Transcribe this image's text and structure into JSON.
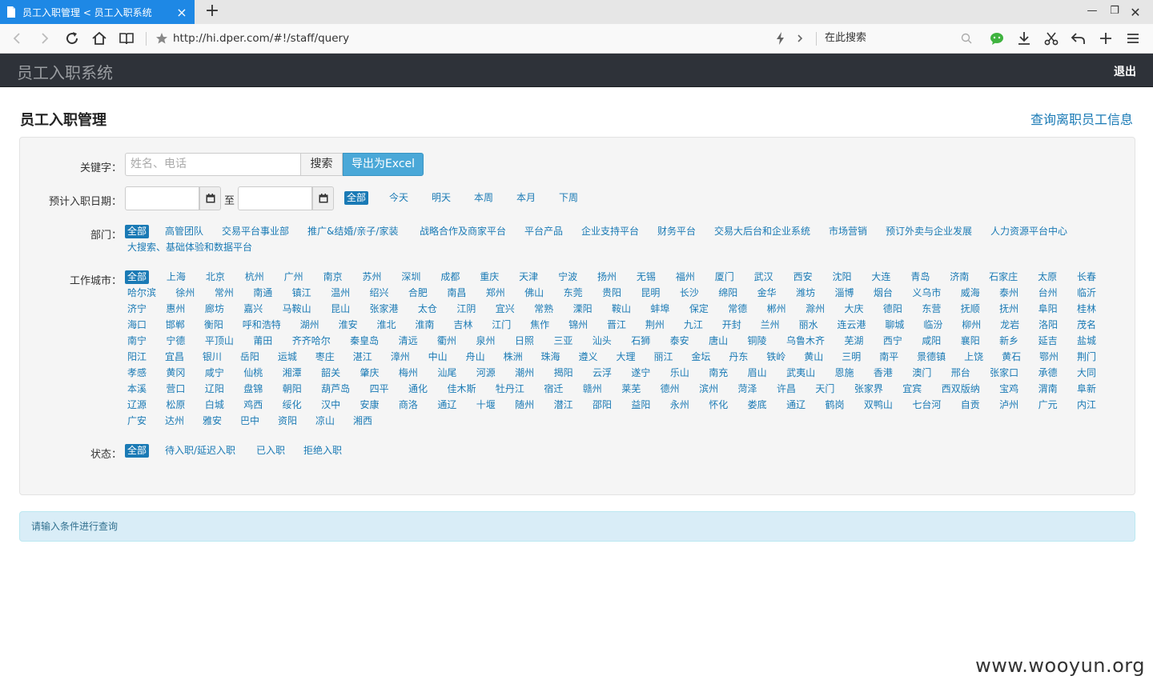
{
  "browser": {
    "tab_title": "员工入职管理 < 员工入职系统",
    "url": "http://hi.dper.com/#!/staff/query",
    "search_placeholder": "在此搜索"
  },
  "app": {
    "brand": "员工入职系统",
    "logout": "退出"
  },
  "page": {
    "title": "员工入职管理",
    "resigned_link": "查询离职员工信息"
  },
  "filters": {
    "keyword_label": "关键字：",
    "keyword_placeholder": "姓名、电话",
    "search_button": "搜索",
    "export_button": "导出为Excel",
    "date_label": "预计入职日期：",
    "date_to": "至",
    "date_options": [
      "全部",
      "今天",
      "明天",
      "本周",
      "本月",
      "下周"
    ],
    "dept_label": "部门：",
    "departments": [
      "全部",
      "高管团队",
      "交易平台事业部",
      "推广&结婚/亲子/家装",
      "战略合作及商家平台",
      "平台产品",
      "企业支持平台",
      "财务平台",
      "交易大后台和企业系统",
      "市场营销",
      "预订外卖与企业发展",
      "人力资源平台中心",
      "大搜索、基础体验和数据平台"
    ],
    "city_label": "工作城市：",
    "cities": [
      [
        "全部",
        "上海",
        "北京",
        "杭州",
        "广州",
        "南京",
        "苏州",
        "深圳",
        "成都",
        "重庆",
        "天津",
        "宁波",
        "扬州",
        "无锡",
        "福州",
        "厦门",
        "武汉",
        "西安",
        "沈阳",
        "大连",
        "青岛",
        "济南",
        "石家庄",
        "太原",
        "长春"
      ],
      [
        "哈尔滨",
        "徐州",
        "常州",
        "南通",
        "镇江",
        "温州",
        "绍兴",
        "合肥",
        "南昌",
        "郑州",
        "佛山",
        "东莞",
        "贵阳",
        "昆明",
        "长沙",
        "绵阳",
        "金华",
        "潍坊",
        "淄博",
        "烟台",
        "义乌市",
        "威海",
        "泰州",
        "台州",
        "临沂"
      ],
      [
        "济宁",
        "惠州",
        "廊坊",
        "嘉兴",
        "马鞍山",
        "昆山",
        "张家港",
        "太仓",
        "江阴",
        "宜兴",
        "常熟",
        "溧阳",
        "鞍山",
        "蚌埠",
        "保定",
        "常德",
        "郴州",
        "滁州",
        "大庆",
        "德阳",
        "东营",
        "抚顺",
        "抚州",
        "阜阳",
        "桂林"
      ],
      [
        "海口",
        "邯郸",
        "衡阳",
        "呼和浩特",
        "湖州",
        "淮安",
        "淮北",
        "淮南",
        "吉林",
        "江门",
        "焦作",
        "锦州",
        "晋江",
        "荆州",
        "九江",
        "开封",
        "兰州",
        "丽水",
        "连云港",
        "聊城",
        "临汾",
        "柳州",
        "龙岩",
        "洛阳",
        "茂名"
      ],
      [
        "南宁",
        "宁德",
        "平顶山",
        "莆田",
        "齐齐哈尔",
        "秦皇岛",
        "清远",
        "衢州",
        "泉州",
        "日照",
        "三亚",
        "汕头",
        "石狮",
        "泰安",
        "唐山",
        "铜陵",
        "乌鲁木齐",
        "芜湖",
        "西宁",
        "咸阳",
        "襄阳",
        "新乡",
        "延吉",
        "盐城"
      ],
      [
        "阳江",
        "宜昌",
        "银川",
        "岳阳",
        "运城",
        "枣庄",
        "湛江",
        "漳州",
        "中山",
        "舟山",
        "株洲",
        "珠海",
        "遵义",
        "大理",
        "丽江",
        "金坛",
        "丹东",
        "铁岭",
        "黄山",
        "三明",
        "南平",
        "景德镇",
        "上饶",
        "黄石",
        "鄂州",
        "荆门"
      ],
      [
        "孝感",
        "黄冈",
        "咸宁",
        "仙桃",
        "湘潭",
        "韶关",
        "肇庆",
        "梅州",
        "汕尾",
        "河源",
        "潮州",
        "揭阳",
        "云浮",
        "遂宁",
        "乐山",
        "南充",
        "眉山",
        "武夷山",
        "恩施",
        "香港",
        "澳门",
        "邢台",
        "张家口",
        "承德",
        "大同"
      ],
      [
        "本溪",
        "营口",
        "辽阳",
        "盘锦",
        "朝阳",
        "葫芦岛",
        "四平",
        "通化",
        "佳木斯",
        "牡丹江",
        "宿迁",
        "赣州",
        "莱芜",
        "德州",
        "滨州",
        "菏泽",
        "许昌",
        "天门",
        "张家界",
        "宜宾",
        "西双版纳",
        "宝鸡",
        "渭南",
        "阜新"
      ],
      [
        "辽源",
        "松原",
        "白城",
        "鸡西",
        "绥化",
        "汉中",
        "安康",
        "商洛",
        "通辽",
        "十堰",
        "随州",
        "潜江",
        "邵阳",
        "益阳",
        "永州",
        "怀化",
        "娄底",
        "通辽",
        "鹤岗",
        "双鸭山",
        "七台河",
        "自贡",
        "泸州",
        "广元",
        "内江"
      ],
      [
        "广安",
        "达州",
        "雅安",
        "巴中",
        "资阳",
        "凉山",
        "湘西"
      ]
    ],
    "status_label": "状态：",
    "statuses": [
      "全部",
      "待入职/延迟入职",
      "已入职",
      "拒绝入职"
    ]
  },
  "alert": "请输入条件进行查询",
  "watermark": "www.wooyun.org"
}
